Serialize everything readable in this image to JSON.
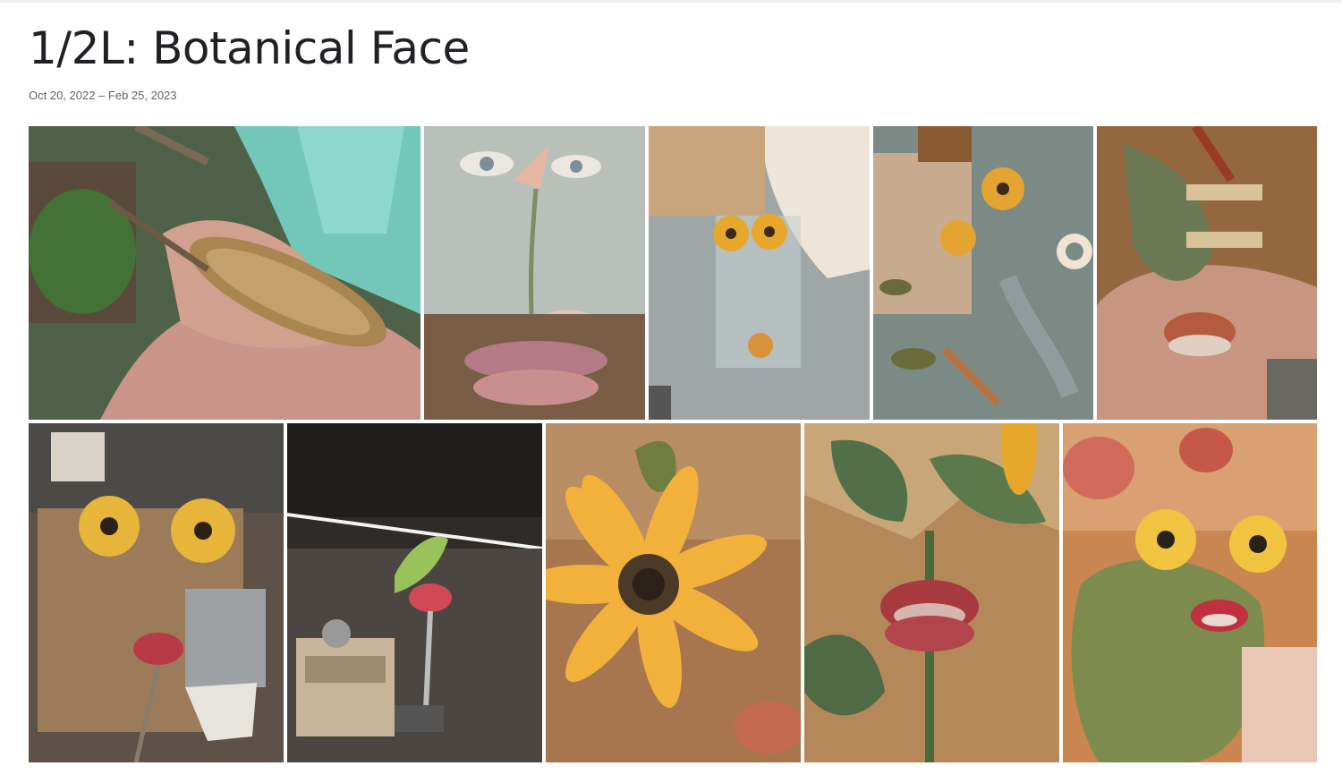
{
  "album": {
    "title": "1/2L: Botanical Face",
    "date_range": "Oct 20, 2022 – Feb 25, 2023"
  },
  "photos": [
    {
      "subject": "spiky seed pod in palm"
    },
    {
      "subject": "eyes on lily flower artwork with seed pod lips"
    },
    {
      "subject": "paper sunflowers in clear tube"
    },
    {
      "subject": "paper flowers on cutting mat with wire"
    },
    {
      "subject": "seed pod mouth held by clothespins"
    },
    {
      "subject": "sunflower eyes with red pod mouth on cardboard"
    },
    {
      "subject": "red pod mouth on stand in workshop"
    },
    {
      "subject": "close-up of paper sunflower"
    },
    {
      "subject": "red pod mouth close-up with leaves"
    },
    {
      "subject": "finished botanical face on painted backdrop"
    }
  ]
}
